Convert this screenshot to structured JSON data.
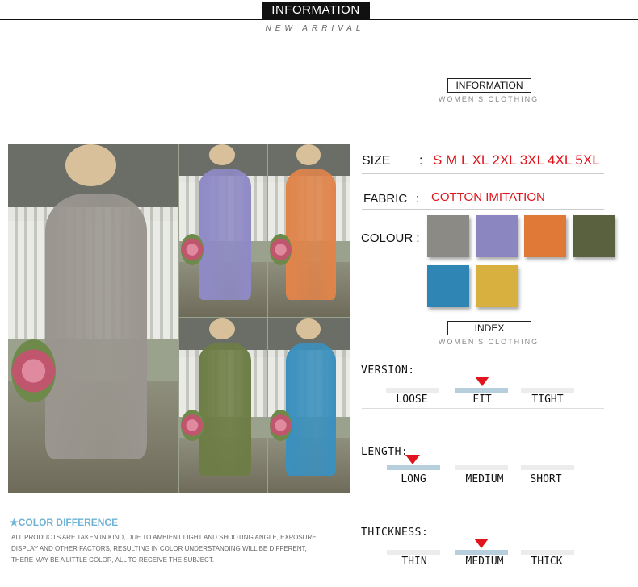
{
  "header": {
    "title": "INFORMATION",
    "subtitle": "NEW ARRIVAL"
  },
  "info_section": {
    "title": "INFORMATION",
    "caption": "WOMEN'S CLOTHING"
  },
  "index_section": {
    "title": "INDEX",
    "caption": "WOMEN'S CLOTHING"
  },
  "specs": {
    "size_label": "SIZE",
    "size_colon": ":",
    "size_value": "S M L XL 2XL 3XL 4XL 5XL",
    "fabric_label": "FABRIC",
    "fabric_colon": ":",
    "fabric_value": "COTTON IMITATION",
    "colour_label": "COLOUR :"
  },
  "colours": [
    {
      "name": "gray",
      "hex": "#8c8a85"
    },
    {
      "name": "purple",
      "hex": "#8c86c0"
    },
    {
      "name": "orange",
      "hex": "#e07838"
    },
    {
      "name": "army green",
      "hex": "#59613e"
    },
    {
      "name": "blue",
      "hex": "#2f86b4"
    },
    {
      "name": "yellow",
      "hex": "#d8b040"
    }
  ],
  "photos": [
    {
      "name": "gray-dress",
      "hex": "#9a968f"
    },
    {
      "name": "purple-dress",
      "hex": "#8f8ac6"
    },
    {
      "name": "orange-dress",
      "hex": "#e0844a"
    },
    {
      "name": "green-dress",
      "hex": "#6d7d45"
    },
    {
      "name": "blue-dress",
      "hex": "#3a90be"
    }
  ],
  "scales": {
    "version": {
      "title": "VERSION:",
      "options": [
        "LOOSE",
        "FIT",
        "TIGHT"
      ],
      "selected": "FIT"
    },
    "length": {
      "title": "LENGTH:",
      "options": [
        "LONG",
        "MEDIUM",
        "SHORT"
      ],
      "selected": "LONG"
    },
    "thickness": {
      "title": "THICKNESS:",
      "options": [
        "THIN",
        "MEDIUM",
        "THICK"
      ],
      "selected": "MEDIUM"
    }
  },
  "color_difference": {
    "title": "★COLOR DIFFERENCE",
    "lines": [
      "ALL PRODUCTS ARE TAKEN IN KIND, DUE TO AMBIENT LIGHT AND SHOOTING ANGLE, EXPOSURE",
      "DISPLAY AND OTHER FACTORS, RESULTING IN COLOR UNDERSTANDING WILL BE DIFFERENT,",
      "THERE MAY BE A LITTLE COLOR, ALL TO RECEIVE THE SUBJECT."
    ]
  },
  "accent_color": "#e0141c"
}
